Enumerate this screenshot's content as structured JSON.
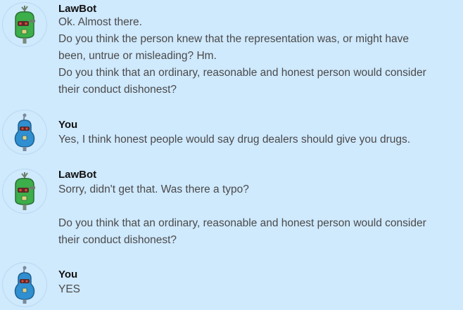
{
  "chat": {
    "messages": [
      {
        "sender": "LawBot",
        "avatar": "lawbot-robot-icon",
        "lines": [
          "Ok. Almost there.",
          "Do you think the person knew that the representation was, or might have",
          "been, untrue or misleading? Hm.",
          "Do you think that an ordinary, reasonable and honest person would consider",
          "their conduct dishonest?"
        ]
      },
      {
        "sender": "You",
        "avatar": "user-robot-icon",
        "lines": [
          "Yes, I think honest people would say drug dealers should give you drugs."
        ]
      },
      {
        "sender": "LawBot",
        "avatar": "lawbot-robot-icon",
        "lines": [
          "Sorry, didn't get that. Was there a typo?",
          "",
          "Do you think that an ordinary, reasonable and honest person would consider",
          "their conduct dishonest?"
        ]
      },
      {
        "sender": "You",
        "avatar": "user-robot-icon",
        "lines": [
          "YES"
        ]
      }
    ]
  },
  "colors": {
    "background": "#cfe9fd",
    "sender_text": "#111111",
    "message_text": "#4a4a4a",
    "lawbot_body": "#3cae4a",
    "user_body": "#2f8fd0"
  }
}
